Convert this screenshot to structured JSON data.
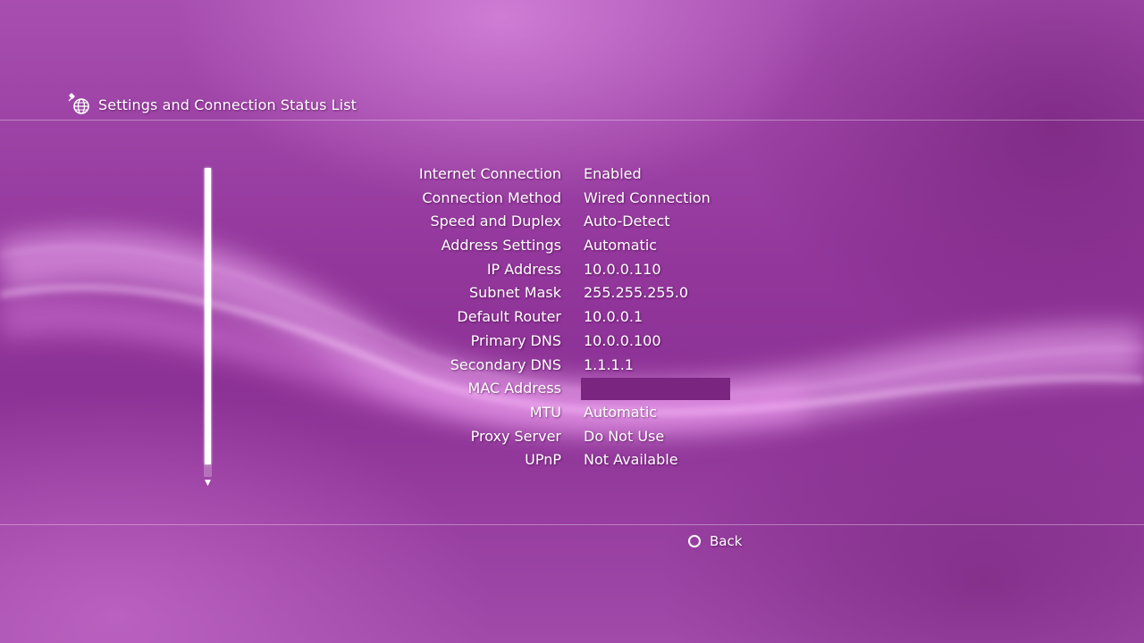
{
  "header": {
    "icon": "network-settings-icon",
    "title": "Settings and Connection Status List"
  },
  "settings": [
    {
      "label": "Internet Connection",
      "value": "Enabled"
    },
    {
      "label": "Connection Method",
      "value": "Wired Connection"
    },
    {
      "label": "Speed and Duplex",
      "value": "Auto-Detect"
    },
    {
      "label": "Address Settings",
      "value": "Automatic"
    },
    {
      "label": "IP Address",
      "value": "10.0.0.110"
    },
    {
      "label": "Subnet Mask",
      "value": "255.255.255.0"
    },
    {
      "label": "Default Router",
      "value": "10.0.0.1"
    },
    {
      "label": "Primary DNS",
      "value": "10.0.0.100"
    },
    {
      "label": "Secondary DNS",
      "value": "1.1.1.1"
    },
    {
      "label": "MAC Address",
      "value": ""
    },
    {
      "label": "MTU",
      "value": "Automatic"
    },
    {
      "label": "Proxy Server",
      "value": "Do Not Use"
    },
    {
      "label": "UPnP",
      "value": "Not Available"
    }
  ],
  "footer": {
    "back_icon": "circle-button-icon",
    "back_label": "Back"
  },
  "colors": {
    "background": "#93379c",
    "text": "#ffffff",
    "redacted_box": "#7a2580"
  }
}
